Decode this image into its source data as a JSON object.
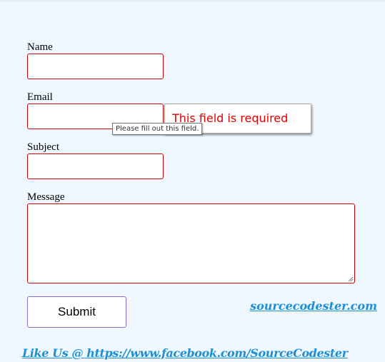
{
  "form": {
    "name_label": "Name",
    "email_label": "Email",
    "subject_label": "Subject",
    "message_label": "Message",
    "name_value": "",
    "email_value": "",
    "subject_value": "",
    "message_value": "",
    "submit_label": "Submit"
  },
  "validation": {
    "error_message": "This field is required",
    "tooltip": "Please fill out this field."
  },
  "links": {
    "site": "sourcecodester.com",
    "facebook": "Like Us @ https://www.facebook.com/SourceCodester"
  },
  "colors": {
    "background": "#f0f8ff",
    "field_border": "#d10000",
    "error_text": "#e00000",
    "link": "#1c8fd6",
    "submit_border": "#8a6fc9"
  }
}
